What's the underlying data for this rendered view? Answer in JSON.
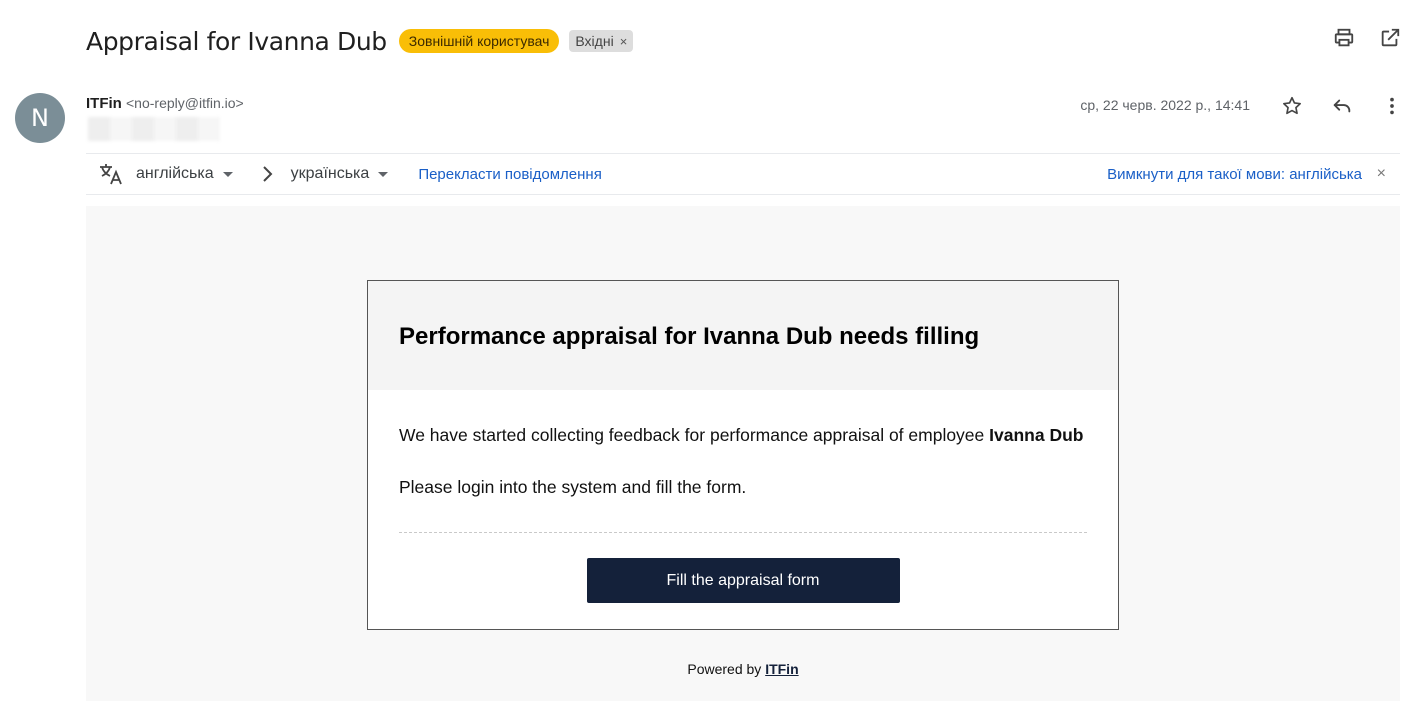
{
  "subject": {
    "title": "Appraisal for Ivanna Dub",
    "labels": {
      "external": "Зовнішній користувач",
      "inbox": "Вхідні",
      "inbox_remove": "×"
    },
    "icons": [
      "printer-icon",
      "open-in-new-window-icon"
    ]
  },
  "sender": {
    "avatar_letter": "N",
    "name": "ITFin",
    "email": "<no-reply@itfin.io>",
    "date": "ср, 22 черв. 2022 р., 14:41",
    "icons": [
      "star-icon",
      "reply-icon",
      "more-vert-icon"
    ]
  },
  "translate": {
    "source_lang": "англійська",
    "target_lang": "українська",
    "translate_link": "Перекласти повідомлення",
    "disable_link": "Вимкнути для такої мови: англійська",
    "close": "×"
  },
  "email": {
    "header_title": "Performance appraisal for Ivanna Dub needs filling",
    "line1_prefix": "We have started collecting feedback for performance appraisal of employee ",
    "line1_bold": "Ivanna Dub",
    "line2": "Please login into the system and fill the form.",
    "cta_label": "Fill the appraisal form",
    "powered_prefix": "Powered by ",
    "powered_brand": "ITFin"
  },
  "colors": {
    "external_label": "#f9be07",
    "cta_background": "#14213a",
    "link": "#1a5fc7",
    "avatar": "#7b8e97"
  }
}
